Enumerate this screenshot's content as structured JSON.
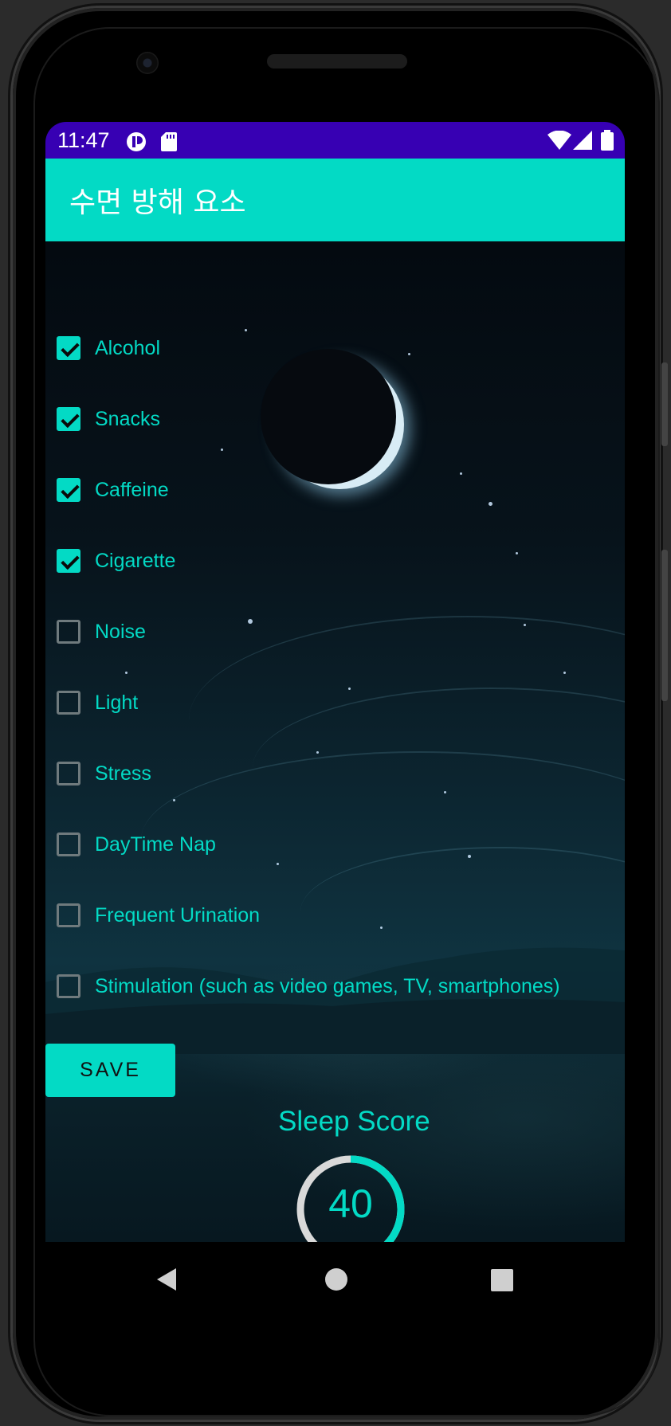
{
  "status_bar": {
    "time": "11:47"
  },
  "app_bar": {
    "title": "수면 방해 요소"
  },
  "factors": [
    {
      "label": "Alcohol",
      "checked": true
    },
    {
      "label": "Snacks",
      "checked": true
    },
    {
      "label": "Caffeine",
      "checked": true
    },
    {
      "label": "Cigarette",
      "checked": true
    },
    {
      "label": "Noise",
      "checked": false
    },
    {
      "label": "Light",
      "checked": false
    },
    {
      "label": "Stress",
      "checked": false
    },
    {
      "label": "DayTime Nap",
      "checked": false
    },
    {
      "label": "Frequent Urination",
      "checked": false
    },
    {
      "label": "Stimulation (such as video games, TV, smartphones)",
      "checked": false
    }
  ],
  "save_button": {
    "label": "SAVE"
  },
  "sleep_score": {
    "title": "Sleep Score",
    "value": "40",
    "progress_fraction": 0.4
  },
  "colors": {
    "accent": "#03dac5",
    "status_bar": "#3700b3",
    "gauge_track": "#d9d9d9"
  },
  "icons": {
    "status_left": [
      "notification-app-icon",
      "sd-card-icon"
    ],
    "status_right": [
      "wifi-icon",
      "cell-signal-icon",
      "battery-icon"
    ],
    "nav": [
      "back-icon",
      "home-icon",
      "recents-icon"
    ]
  }
}
